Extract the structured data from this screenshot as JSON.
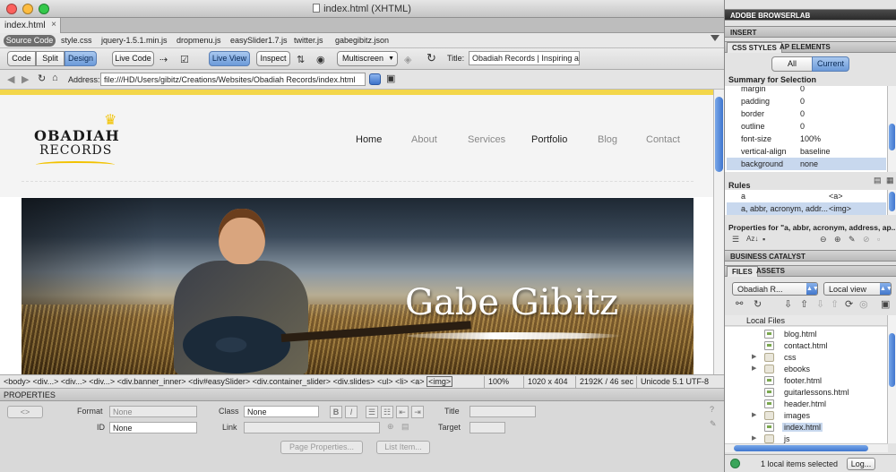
{
  "window": {
    "title": "index.html (XHTML)",
    "light_colors": [
      "#fc615d",
      "#fdbc40",
      "#34c84a"
    ]
  },
  "document_tab": {
    "label": "index.html",
    "close": "×"
  },
  "related_files": {
    "source_code": "Source Code",
    "files": [
      "style.css",
      "jquery-1.5.1.min.js",
      "dropmenu.js",
      "easySlider1.7.js",
      "twitter.js",
      "gabegibitz.json"
    ]
  },
  "toolbar": {
    "code": "Code",
    "split": "Split",
    "design": "Design",
    "live_code": "Live Code",
    "live_view": "Live View",
    "inspect": "Inspect",
    "multiscreen": "Multiscreen",
    "title_label": "Title:",
    "title_value": "Obadiah Records | Inspiring and"
  },
  "address": {
    "label": "Address:",
    "value": "file:///HD/Users/gibitz/Creations/Websites/Obadiah Records/index.html"
  },
  "site": {
    "logo_line1": "OBADIAH",
    "logo_line2": "RECORDS",
    "nav": [
      "Home",
      "About",
      "Services",
      "Portfolio",
      "Blog",
      "Contact"
    ],
    "banner_title": "Gabe Gibitz"
  },
  "tag_selector": {
    "tags": [
      "<body>",
      "<div...>",
      "<div...>",
      "<div...>",
      "<div.banner_inner>",
      "<div#easySlider>",
      "<div.container_slider>",
      "<div.slides>",
      "<ul>",
      "<li>",
      "<a>"
    ],
    "current": "<img>",
    "zoom": "100%",
    "size": "1020 x 404",
    "download": "2192K / 46 sec",
    "encoding": "Unicode 5.1 UTF-8"
  },
  "properties": {
    "header": "PROPERTIES",
    "format_label": "Format",
    "format_value": "None",
    "id_label": "ID",
    "id_value": "None",
    "class_label": "Class",
    "class_value": "None",
    "link_label": "Link",
    "title_label": "Title",
    "target_label": "Target",
    "bold": "B",
    "italic": "I",
    "page_properties": "Page Properties...",
    "list_item": "List Item..."
  },
  "panels": {
    "browserlab": "ADOBE BROWSERLAB",
    "insert": "INSERT",
    "css_styles": "CSS STYLES",
    "ap_elements": "AP ELEMENTS",
    "all": "All",
    "current": "Current",
    "summary": "Summary for Selection",
    "summary_rows": [
      {
        "k": "margin",
        "v": "0"
      },
      {
        "k": "padding",
        "v": "0"
      },
      {
        "k": "border",
        "v": "0"
      },
      {
        "k": "outline",
        "v": "0"
      },
      {
        "k": "font-size",
        "v": "100%"
      },
      {
        "k": "vertical-align",
        "v": "baseline"
      },
      {
        "k": "background",
        "v": "none"
      }
    ],
    "rules": "Rules",
    "rule_rows": [
      {
        "k": "a",
        "v": "<a>"
      },
      {
        "k": "a, abbr, acronym, addr...",
        "v": "<img>"
      }
    ],
    "properties_for": "Properties for \"a, abbr, acronym, address, ap...",
    "business_catalyst": "BUSINESS CATALYST",
    "files": "FILES",
    "assets": "ASSETS",
    "site_select": "Obadiah R...",
    "view_select": "Local view",
    "local_files": "Local Files",
    "file_tree": [
      {
        "name": "blog.html",
        "type": "doc"
      },
      {
        "name": "contact.html",
        "type": "doc"
      },
      {
        "name": "css",
        "type": "folder"
      },
      {
        "name": "ebooks",
        "type": "folder"
      },
      {
        "name": "footer.html",
        "type": "doc"
      },
      {
        "name": "guitarlessons.html",
        "type": "doc"
      },
      {
        "name": "header.html",
        "type": "doc"
      },
      {
        "name": "images",
        "type": "folder"
      },
      {
        "name": "index.html",
        "type": "doc",
        "selected": true
      },
      {
        "name": "js",
        "type": "folder"
      }
    ],
    "status": "1 local items selected",
    "log": "Log..."
  }
}
